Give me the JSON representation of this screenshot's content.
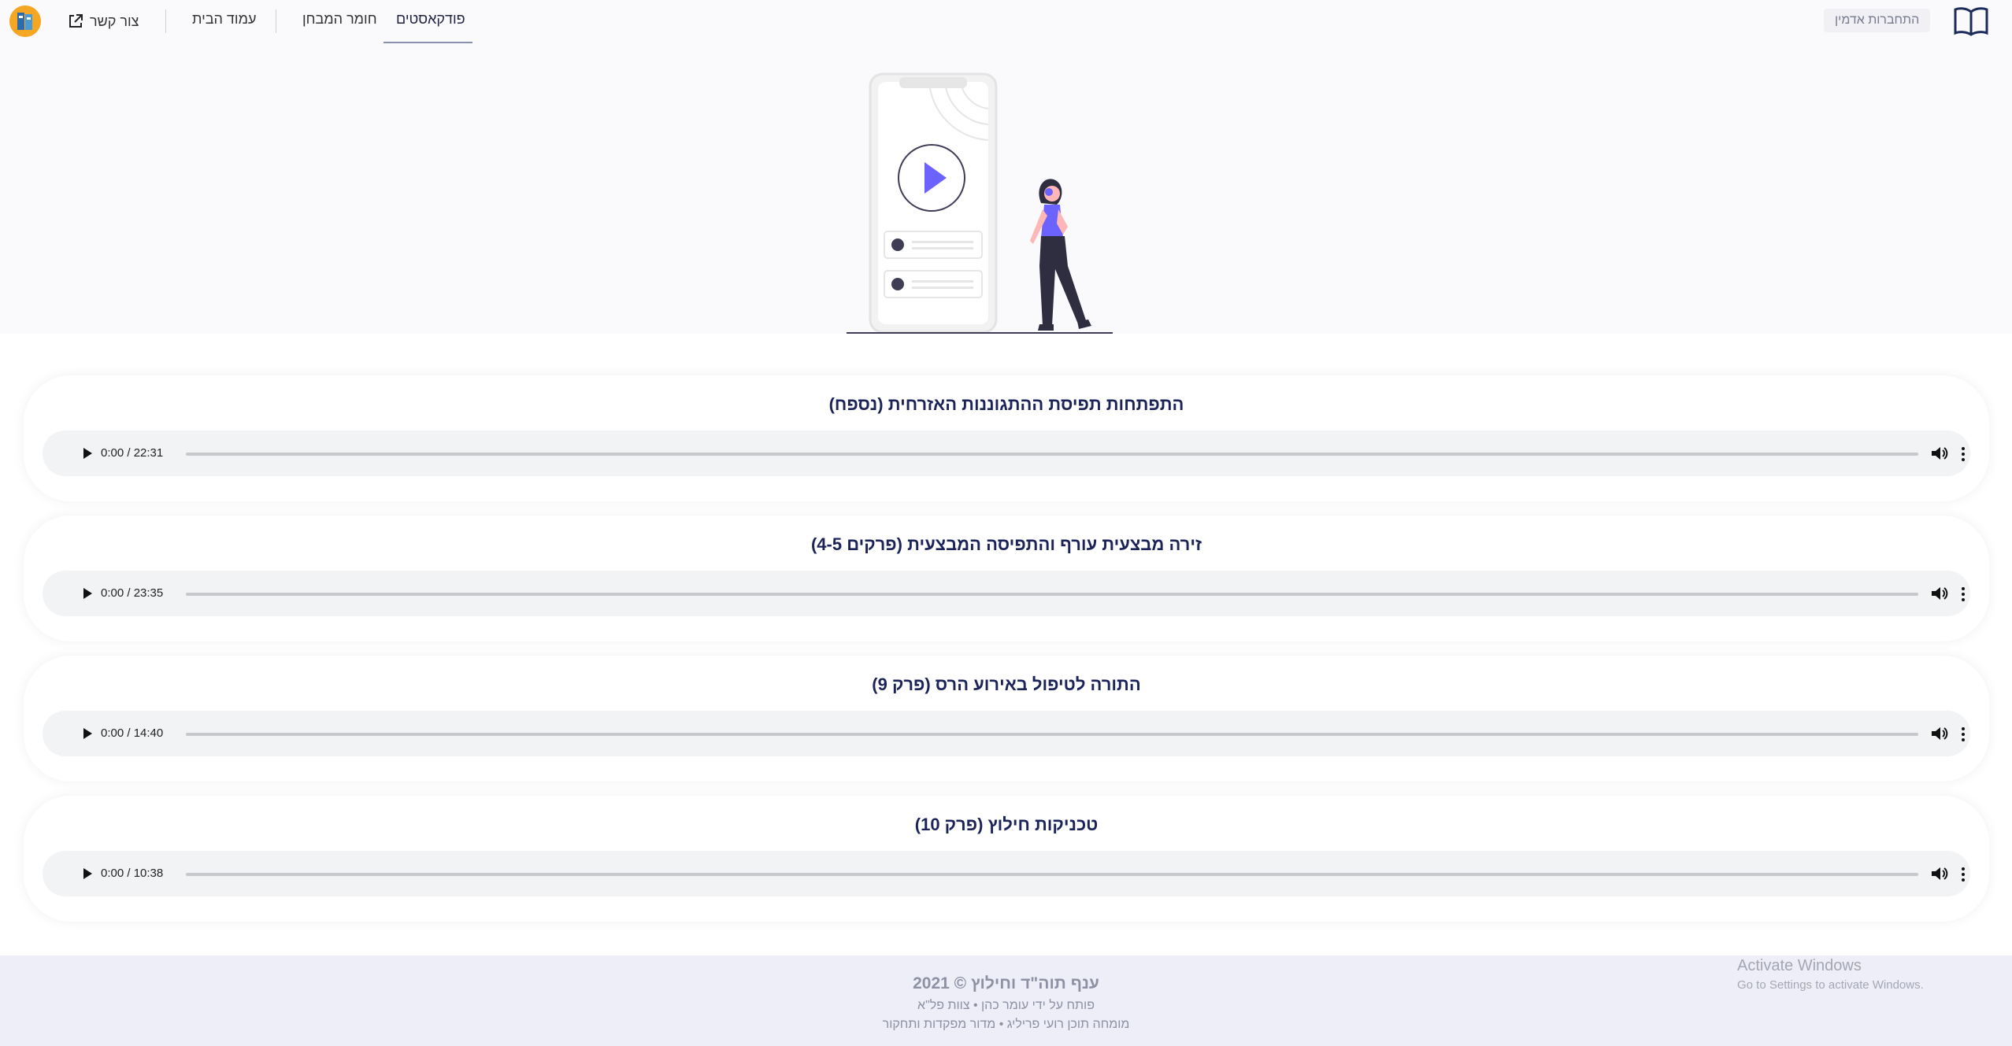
{
  "header": {
    "admin_login": "התחברות אדמין",
    "nav": {
      "contact": "צור קשר",
      "home": "עמוד הבית",
      "exam_material": "חומר המבחן",
      "podcasts": "פודקאסטים"
    }
  },
  "episodes": [
    {
      "title": "התפתחות תפיסת ההתגוננות האזרחית (נספח)",
      "time": "0:00 / 22:31"
    },
    {
      "title": "זירה מבצעית עורף והתפיסה המבצעית (פרקים 4-5)",
      "time": "0:00 / 23:35"
    },
    {
      "title": "התורה לטיפול באירוע הרס (פרק 9)",
      "time": "0:00 / 14:40"
    },
    {
      "title": "טכניקות חילוץ (פרק 10)",
      "time": "0:00 / 10:38"
    }
  ],
  "footer": {
    "line1": "ענף תוה\"ד וחילוץ © 2021",
    "line2": "פותח על ידי עומר כהן • צוות פל\"א",
    "line3": "מומחה תוכן רועי פריליג • מדור מפקדות ותחקור"
  },
  "watermark": {
    "line1": "Activate Windows",
    "line2": "Go to Settings to activate Windows."
  }
}
